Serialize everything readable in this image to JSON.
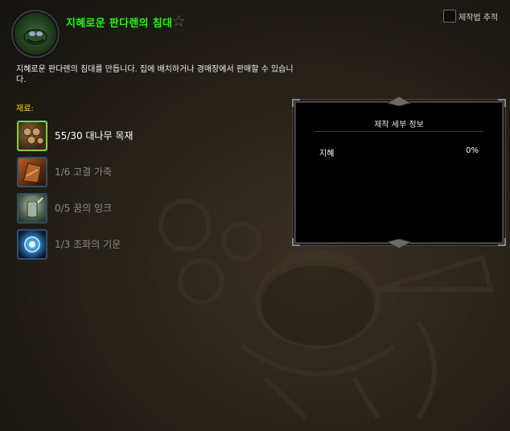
{
  "recipe": {
    "title": "지혜로운 판다렌의 침대",
    "icon": "pandaren-bed-icon",
    "description": "지혜로운 판다렌의 침대를 만듭니다. 집에 배치하거나 경매장에서 판매할 수 있습니다."
  },
  "header": {
    "favorite_icon": "star-icon",
    "track_label": "제작법 추적",
    "track_checked": false
  },
  "reagents": {
    "label": "재료:",
    "items": [
      {
        "text": "55/30 대나무 목재",
        "icon": "bamboo-lumber-icon",
        "fulfilled": true
      },
      {
        "text": "1/6 고결 가죽",
        "icon": "noble-leather-icon",
        "fulfilled": false
      },
      {
        "text": "0/5 꿈의 잉크",
        "icon": "dream-ink-icon",
        "fulfilled": false
      },
      {
        "text": "1/3 조화의 기운",
        "icon": "harmony-essence-icon",
        "fulfilled": false
      }
    ]
  },
  "details": {
    "title": "제작 세부 정보",
    "stat_name": "지혜",
    "stat_value": "0%"
  },
  "colors": {
    "title": "#1eff00",
    "reagent_label": "#ffd200",
    "fulfilled_text": "#ffffff",
    "unfulfilled_text": "#8a8a8a"
  }
}
